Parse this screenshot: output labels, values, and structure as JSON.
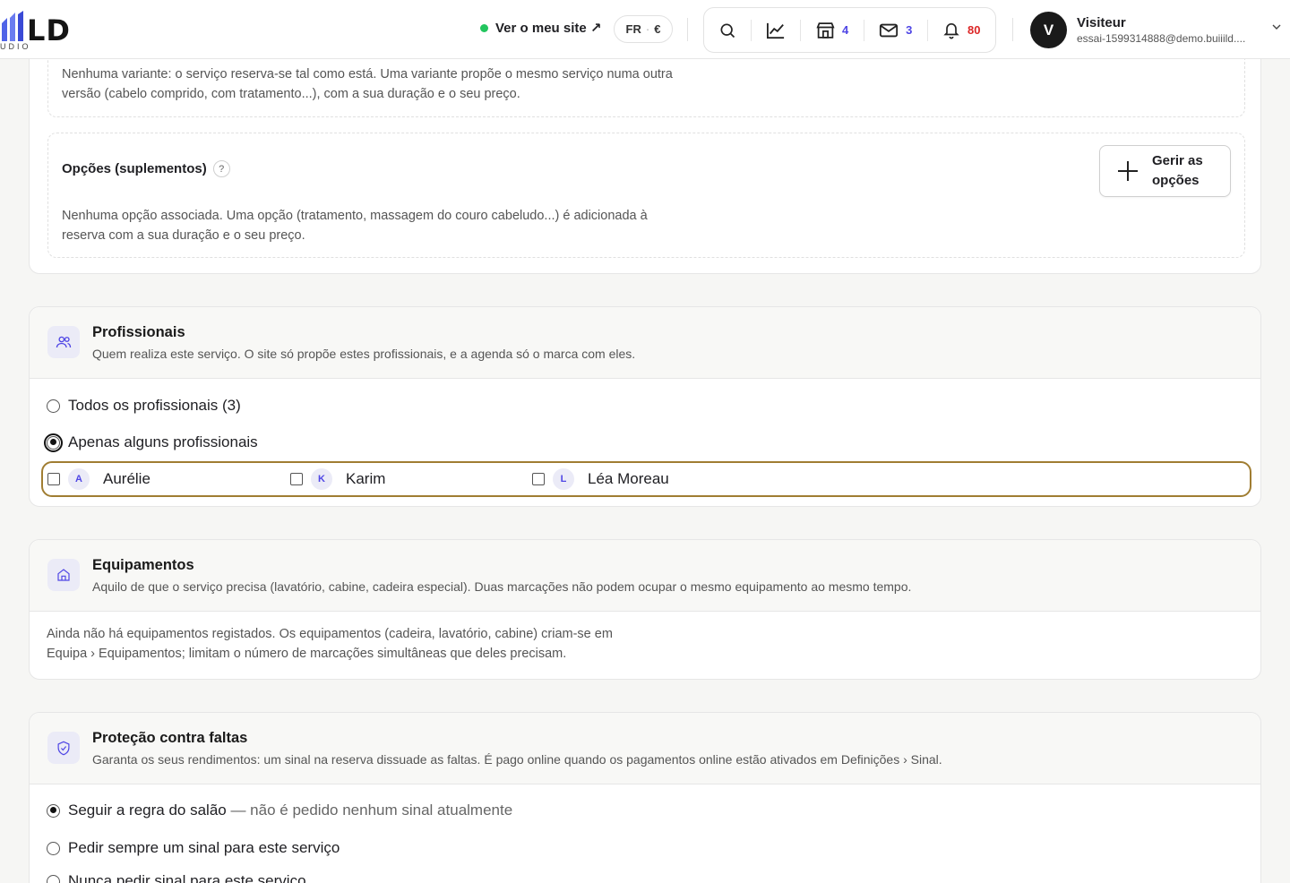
{
  "header": {
    "logo_text": "LD",
    "logo_sub": "UDIO",
    "visit_site": "Ver o meu site ↗",
    "lang": "FR",
    "currency": "€",
    "icons": [
      {
        "name": "search-icon"
      },
      {
        "name": "chart-icon"
      },
      {
        "name": "store-icon",
        "count": "4"
      },
      {
        "name": "mail-icon",
        "count": "3"
      },
      {
        "name": "bell-icon",
        "count": "80"
      }
    ],
    "user": {
      "initial": "V",
      "name": "Visiteur",
      "email": "essai-1599314888@demo.buiiild...."
    }
  },
  "variants": {
    "empty_text": "Nenhuma variante: o serviço reserva-se tal como está. Uma variante propõe o mesmo serviço numa outra versão (cabelo comprido, com tratamento...), com a sua duração e o seu preço."
  },
  "options": {
    "title": "Opções (suplementos)",
    "help": "?",
    "manage_button": "Gerir as opções",
    "empty_text": "Nenhuma opção associada. Uma opção (tratamento, massagem do couro cabeludo...) é adicionada à reserva com a sua duração e o seu preço."
  },
  "professionals": {
    "title": "Profissionais",
    "subtitle": "Quem realiza este serviço. O site só propõe estes profissionais, e a agenda só o marca com eles.",
    "choice_all": "Todos os profissionais (3)",
    "choice_some": "Apenas alguns profissionais",
    "list": [
      {
        "initial": "A",
        "name": "Aurélie",
        "checked": false
      },
      {
        "initial": "K",
        "name": "Karim",
        "checked": false
      },
      {
        "initial": "L",
        "name": "Léa Moreau",
        "checked": false
      }
    ]
  },
  "equipment": {
    "title": "Equipamentos",
    "subtitle": "Aquilo de que o serviço precisa (lavatório, cabine, cadeira especial). Duas marcações não podem ocupar o mesmo equipamento ao mesmo tempo.",
    "empty_text": "Ainda não há equipamentos registados. Os equipamentos (cadeira, lavatório, cabine) criam-se em Equipa › Equipamentos; limitam o número de marcações simultâneas que deles precisam."
  },
  "noshow": {
    "title": "Proteção contra faltas",
    "subtitle": "Garanta os seus rendimentos: um sinal na reserva dissuade as faltas. É pago online quando os pagamentos online estão ativados em Definições › Sinal.",
    "choice_salon": "Seguir a regra do salão",
    "choice_salon_note": " — não é pedido nenhum sinal atualmente",
    "choice_always": "Pedir sempre um sinal para este serviço",
    "choice_never": "Nunca pedir sinal para este serviço"
  }
}
